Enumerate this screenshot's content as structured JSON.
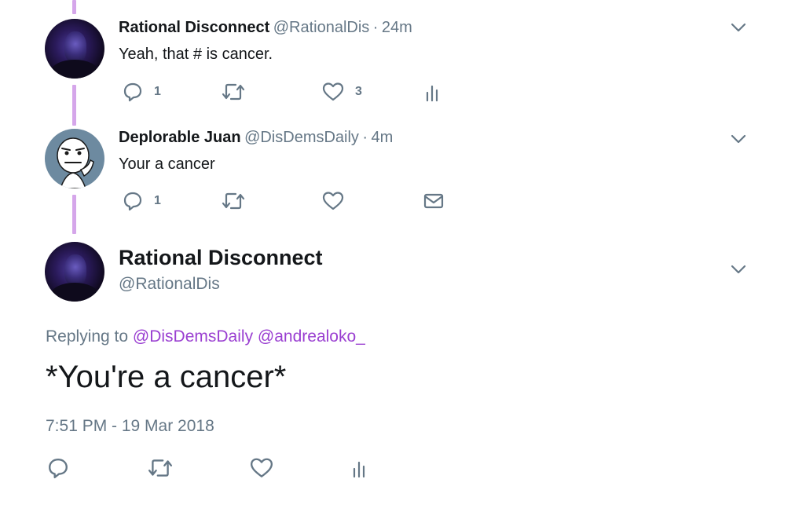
{
  "tweets": [
    {
      "name": "Rational Disconnect",
      "handle": "@RationalDis",
      "sep": "·",
      "time": "24m",
      "text": "Yeah, that # is cancer.",
      "reply_count": "1",
      "like_count": "3"
    },
    {
      "name": "Deplorable Juan",
      "handle": "@DisDemsDaily",
      "sep": "·",
      "time": "4m",
      "text": "Your a cancer",
      "reply_count": "1"
    }
  ],
  "focused": {
    "name": "Rational Disconnect",
    "handle": "@RationalDis",
    "replying_prefix": "Replying to",
    "mention1": "@DisDemsDaily",
    "mention2": "@andrealoko_",
    "text": "*You're a cancer*",
    "timestamp": "7:51 PM - 19 Mar 2018"
  },
  "colors": {
    "thread_line": "#d5a6ea",
    "mention": "#9a3fd1",
    "secondary_text": "#657786"
  }
}
